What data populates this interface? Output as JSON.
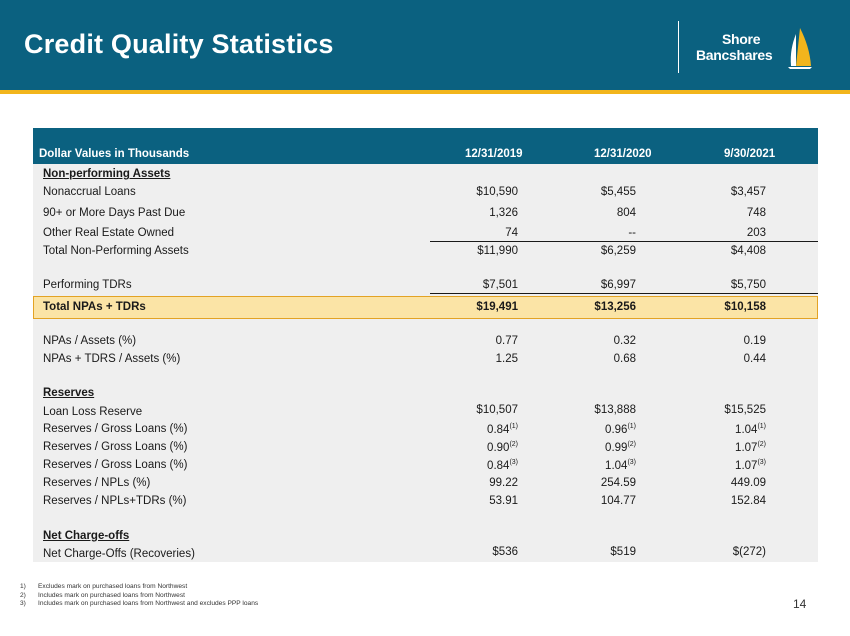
{
  "header": {
    "title": "Credit Quality Statistics",
    "logo_line1": "Shore",
    "logo_line2": "Bancshares",
    "colors": {
      "band": "#0b6180",
      "stripe": "#f2b51c",
      "sail_yellow": "#f2b51c",
      "sail_white": "#ffffff"
    }
  },
  "table": {
    "headers": [
      "Dollar Values in Thousands",
      "12/31/2019",
      "12/31/2020",
      "9/30/2021"
    ],
    "sections": {
      "npa": "Non-performing Assets",
      "reserves": "Reserves",
      "charge_offs": "Net Charge-offs"
    },
    "rows": {
      "nonaccrual": {
        "label": "Nonaccrual Loans",
        "v": [
          "$10,590",
          "$5,455",
          "$3,457"
        ]
      },
      "past_due": {
        "label": "90+ or More Days Past Due",
        "v": [
          "1,326",
          "804",
          "748"
        ]
      },
      "oreo": {
        "label": "Other Real Estate Owned",
        "v": [
          "74",
          "--",
          "203"
        ]
      },
      "total_npa": {
        "label": "Total Non-Performing Assets",
        "v": [
          "$11,990",
          "$6,259",
          "$4,408"
        ]
      },
      "tdrs": {
        "label": "Performing TDRs",
        "v": [
          "$7,501",
          "$6,997",
          "$5,750"
        ]
      },
      "total_npa_tdr": {
        "label": "Total NPAs + TDRs",
        "v": [
          "$19,491",
          "$13,256",
          "$10,158"
        ]
      },
      "npa_assets": {
        "label": "NPAs / Assets (%)",
        "v": [
          "0.77",
          "0.32",
          "0.19"
        ]
      },
      "npa_tdr_assets": {
        "label": "NPAs + TDRS / Assets (%)",
        "v": [
          "1.25",
          "0.68",
          "0.44"
        ]
      },
      "llr": {
        "label": "Loan Loss Reserve",
        "v": [
          "$10,507",
          "$13,888",
          "$15,525"
        ]
      },
      "res_gross_1": {
        "label": "Reserves / Gross Loans (%)",
        "v": [
          "0.84",
          "0.96",
          "1.04"
        ],
        "note": "(1)"
      },
      "res_gross_2": {
        "label": "Reserves / Gross Loans (%)",
        "v": [
          "0.90",
          "0.99",
          "1.07"
        ],
        "note": "(2)"
      },
      "res_gross_3": {
        "label": "Reserves / Gross Loans (%)",
        "v": [
          "0.84",
          "1.04",
          "1.07"
        ],
        "note": "(3)"
      },
      "res_npl": {
        "label": "Reserves / NPLs (%)",
        "v": [
          "99.22",
          "254.59",
          "449.09"
        ]
      },
      "res_npl_tdr": {
        "label": "Reserves / NPLs+TDRs (%)",
        "v": [
          "53.91",
          "104.77",
          "152.84"
        ]
      },
      "nco": {
        "label": "Net Charge-Offs (Recoveries)",
        "v": [
          "$536",
          "$519",
          "$(272)"
        ]
      }
    }
  },
  "footnotes": [
    {
      "num": "1)",
      "text": "Excludes mark on purchased loans from Northwest"
    },
    {
      "num": "2)",
      "text": "Includes mark on purchased loans from Northwest"
    },
    {
      "num": "3)",
      "text": "Includes mark on purchased loans from Northwest and excludes PPP loans"
    }
  ],
  "page_number": "14"
}
